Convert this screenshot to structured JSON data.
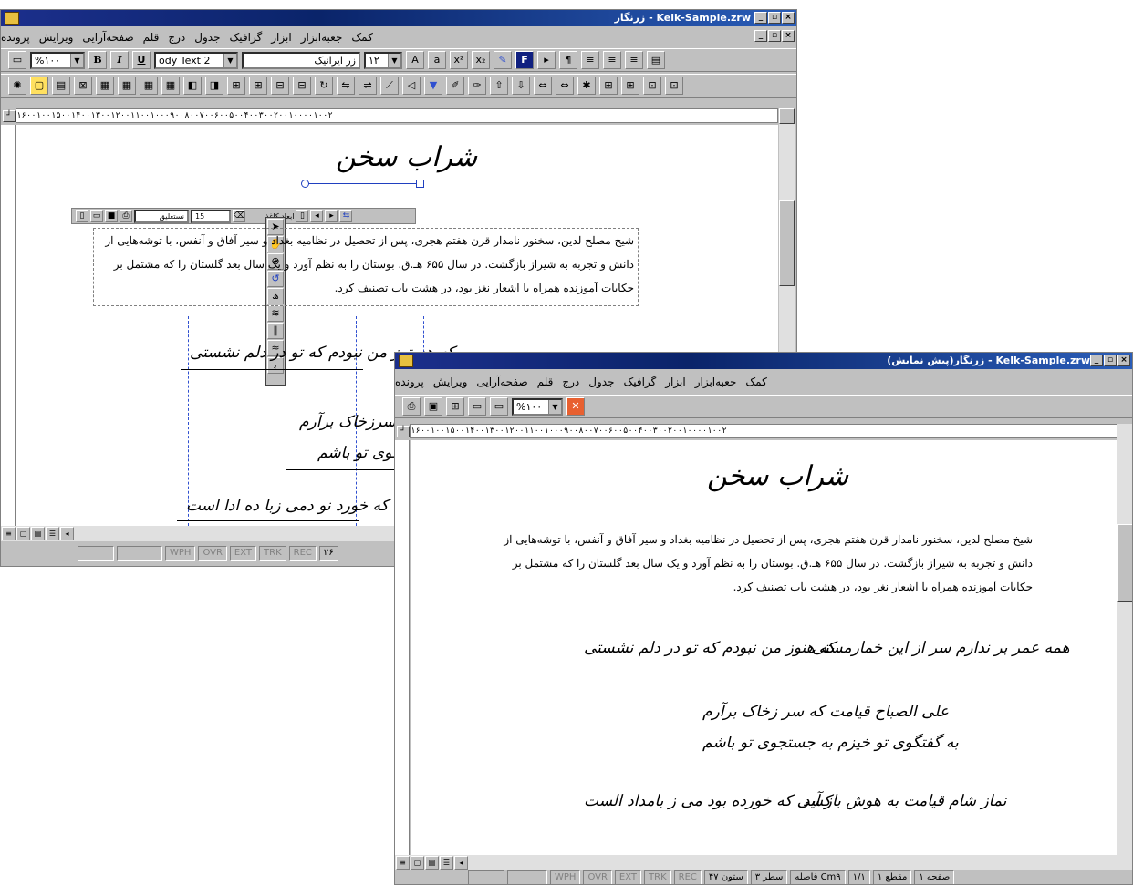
{
  "back_window": {
    "title": "Kelk-Sample.zrw - زرنگار",
    "menu": [
      "پرونده",
      "ویرایش",
      "صفحه‌آرایی",
      "قلم",
      "درج",
      "جدول",
      "گرافیک",
      "ابزار",
      "جعبه‌ابزار",
      "کمک"
    ],
    "zoom": "%۱۰۰",
    "style": "ody Text 2",
    "font": "زر ایرانیک",
    "font_size": "۱۲",
    "tool_font": "نستعلیق",
    "tool_size": "15",
    "tool_dim_label": "ابعاد کاغذ",
    "ruler_text": "۱۶۰۰۱۰۰۱۵۰۰۱۴۰۰۱۳۰۰۱۲۰۰۱۱۰۰۱۰۰۰۹۰۰۸۰۰۷۰۰۶۰۰۵۰۰۴۰۰۳۰۰۲۰۰۱۰۰۰۰۱۰۰۲",
    "doc_title": "شراب سخن",
    "paragraph": [
      "شیخ مصلح لدین، سخنور نامدار قرن هفتم هجری، پس از تحصیل در نظامیه بغداد و سیر آفاق و آنفس، با توشه‌هایی از",
      "دانش و تجربه به شیراز بازگشت. در سال ۶۵۵ هـ.ق. بوستان را به نظم آورد و یک سال بعد گلستان را که مشتمل بر",
      "حکایات آموزنده همراه با اشعار نغز بود، در هشت باب تصنیف کرد."
    ],
    "verses": [
      "که هستوز من نبودم که تو در دلم نشستی",
      "که سرزخاک برآرم",
      "م به جستجوی تو باشم",
      "کسی که خورد نو دمی زبا ده ادا است"
    ],
    "status": [
      "WPH",
      "OVR",
      "EXT",
      "TRK",
      "REC",
      "۲۶"
    ]
  },
  "front_window": {
    "title": "Kelk-Sample.zrw - زرنگار(پیش نمایش)",
    "menu": [
      "پرونده",
      "ویرایش",
      "صفحه‌آرایی",
      "قلم",
      "درج",
      "جدول",
      "گرافیک",
      "ابزار",
      "جعبه‌ابزار",
      "کمک"
    ],
    "zoom": "%۱۰۰",
    "ruler_text": "۱۶۰۰۱۰۰۱۵۰۰۱۴۰۰۱۳۰۰۱۲۰۰۱۱۰۰۱۰۰۰۹۰۰۸۰۰۷۰۰۶۰۰۵۰۰۴۰۰۳۰۰۲۰۰۱۰۰۰۰۱۰۰۲",
    "doc_title": "شراب سخن",
    "paragraph": [
      "شیخ مصلح لدین، سخنور نامدار قرن هفتم هجری، پس از تحصیل در نظامیه بغداد و سیر آفاق و آنفس، با توشه‌هایی از",
      "دانش و تجربه به شیراز بازگشت. در سال ۶۵۵ هـ.ق. بوستان را به نظم آورد و یک سال بعد گلستان را که مشتمل بر",
      "حکایات آموزنده همراه با اشعار نغز بود، در هشت باب تصنیف کرد."
    ],
    "verses": [
      "همه عمر بر ندارم سر از این خمارمستی",
      "که هنوز من نبودم که تو در دلم نشستی",
      "علی الصباح قیامت که سر زخاک برآرم",
      "به گفتگوی تو خیزم به جستجوی تو باشم",
      "نماز شام قیامت به هوش باز آید",
      "کسی که خورده بود می ز بامداد الست"
    ],
    "status": [
      "WPH",
      "OVR",
      "EXT",
      "TRK",
      "REC",
      "ستون ۴۷",
      "سطر ۳",
      "Cm۹ فاصله",
      "۱/۱",
      "مقطع ۱",
      "صفحه ۱"
    ]
  }
}
